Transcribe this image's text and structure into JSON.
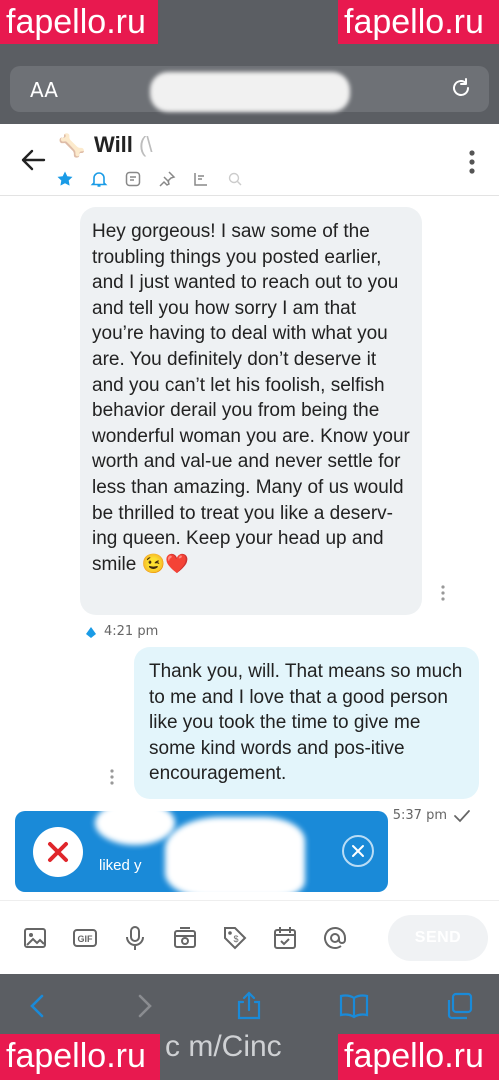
{
  "watermarks": {
    "top_left": "fapello.ru",
    "top_right": "fapello.ru",
    "bottom_left": "fapello.ru",
    "bottom_right": "fapello.ru",
    "bottom_url": "c m/Cinc"
  },
  "browser": {
    "aa_label": "AA",
    "reload_icon": "reload-icon"
  },
  "chat": {
    "name": "Will",
    "name_suffix": "(\\",
    "contact_icon": "bone-icon",
    "header_icons": [
      "star-icon",
      "bell-icon",
      "note-icon",
      "pin-icon",
      "media-icon",
      "search-icon"
    ]
  },
  "messages": [
    {
      "direction": "incoming",
      "text": "Hey gorgeous! I saw some of the troubling things you posted earlier, and I just wanted to reach out to you and tell you how sorry I am that you’re having to deal with what you are. You definitely don’t deserve it and you can’t let his foolish, selfish behavior derail you from being the wonderful woman you are. Know your worth and val-ue and never settle for less than amazing. Many of us would be thrilled to treat you like a deserv-ing queen. Keep your head up and smile 😉❤️",
      "time": "4:21 pm"
    },
    {
      "direction": "outgoing",
      "text": "Thank you, will. That means so much to me and I love that a good person like you took the time to give me some kind words and pos-itive encouragement.",
      "time": "5:37 pm"
    }
  ],
  "notification": {
    "text": "liked y"
  },
  "composer": {
    "send_label": "SEND",
    "tools": [
      "image-icon",
      "gif-icon",
      "microphone-icon",
      "camera-icon",
      "price-tag-icon",
      "calendar-icon",
      "mention-icon"
    ]
  },
  "safari_toolbar": [
    "back-icon",
    "forward-icon",
    "share-icon",
    "bookmarks-icon",
    "tabs-icon"
  ],
  "colors": {
    "chrome_gray": "#5b5e63",
    "incoming_bubble": "#eef1f3",
    "outgoing_bubble": "#e3f5fb",
    "notification_blue": "#1a8ad8",
    "accent_blue": "#1a9be6",
    "watermark_red": "#e8194f"
  }
}
